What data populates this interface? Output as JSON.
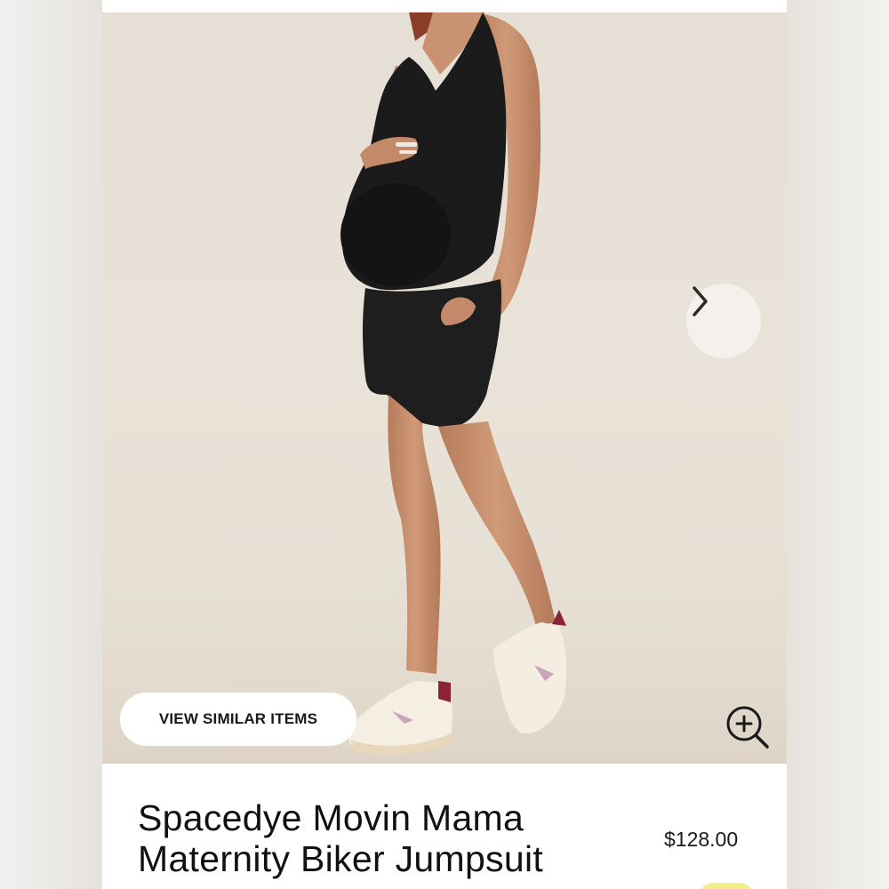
{
  "product": {
    "title_line1": "Spacedye Movin Mama",
    "title_line2": "Maternity Biker Jumpsuit",
    "price": "$128.00"
  },
  "gallery": {
    "similar_label": "VIEW SIMILAR ITEMS",
    "next_icon": "chevron-right-icon",
    "zoom_icon": "zoom-in-icon"
  },
  "colors": {
    "garment": "#1b1b1b",
    "background": "#e6e0d6",
    "skin": "#c9916f"
  }
}
